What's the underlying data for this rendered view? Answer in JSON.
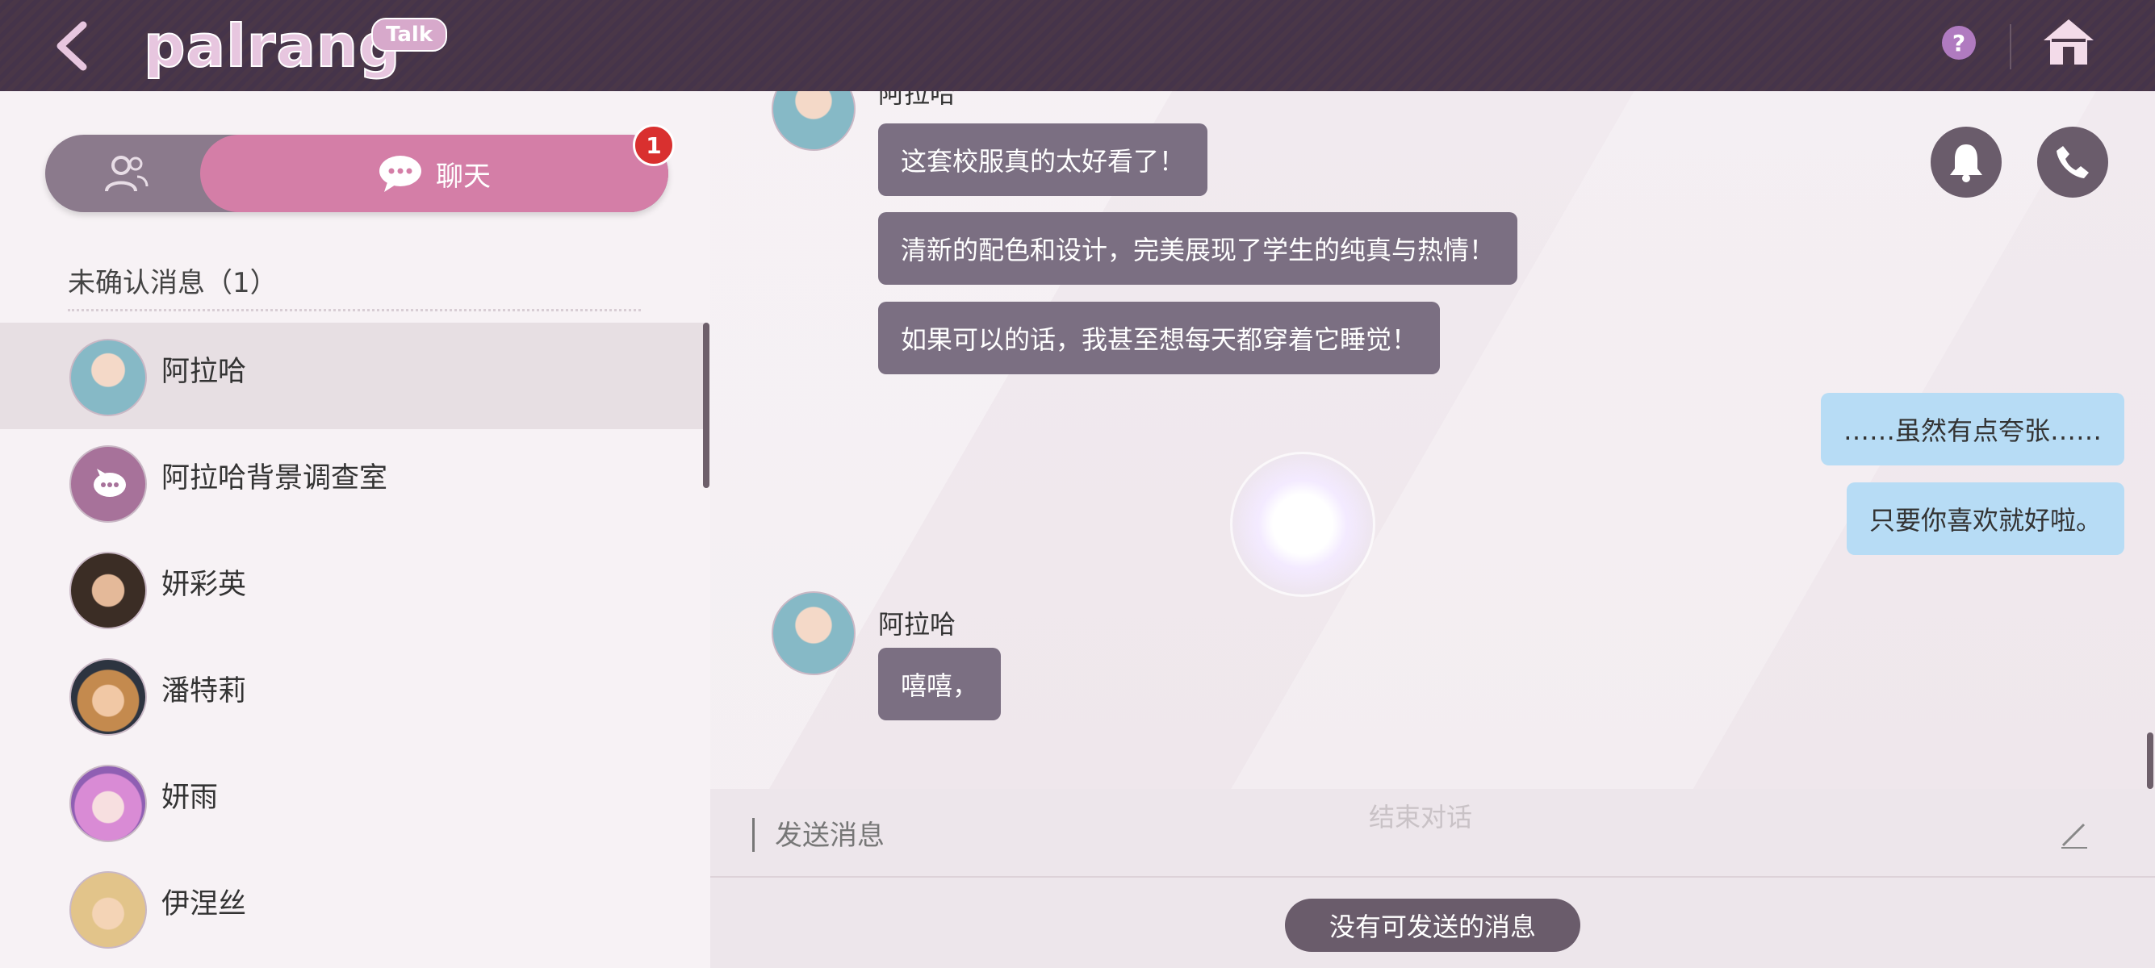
{
  "header": {
    "logo_text": "palrang",
    "logo_tag": "Talk",
    "help_label": "?"
  },
  "sidebar": {
    "tabs": [
      {
        "id": "contacts",
        "icon": "contacts-icon"
      },
      {
        "id": "chat",
        "label": "聊天",
        "icon": "chat-bubble-icon",
        "badge": "1"
      }
    ],
    "section_title": "未确认消息（1）",
    "contacts": [
      {
        "name": "阿拉哈",
        "active": true,
        "avatar_color": "#86b9c6"
      },
      {
        "name": "阿拉哈背景调查室",
        "active": false,
        "avatar_color": "#a7729a"
      },
      {
        "name": "妍彩英",
        "active": false,
        "avatar_color": "#5a4a3a"
      },
      {
        "name": "潘特莉",
        "active": false,
        "avatar_color": "#c48a4e"
      },
      {
        "name": "妍雨",
        "active": false,
        "avatar_color": "#d98bd5"
      },
      {
        "name": "伊涅丝",
        "active": false,
        "avatar_color": "#e2c48a"
      }
    ]
  },
  "chat": {
    "top_sender": "阿拉哈",
    "messages_in_1": [
      "这套校服真的太好看了！",
      "清新的配色和设计，完美展现了学生的纯真与热情！",
      "如果可以的话，我甚至想每天都穿着它睡觉！"
    ],
    "messages_out": [
      "……虽然有点夸张……",
      "只要你喜欢就好啦。"
    ],
    "sender_2": "阿拉哈",
    "messages_in_2": [
      "嘻嘻，"
    ]
  },
  "input": {
    "end_chat_label": "结束对话",
    "placeholder": "发送消息",
    "no_message_label": "没有可发送的消息"
  },
  "colors": {
    "topbar": "#4a3748",
    "chat_tab": "#d47ea7",
    "incoming_bubble": "#7b6f82",
    "outgoing_bubble": "#b7dcf5",
    "badge": "#d9302f"
  }
}
